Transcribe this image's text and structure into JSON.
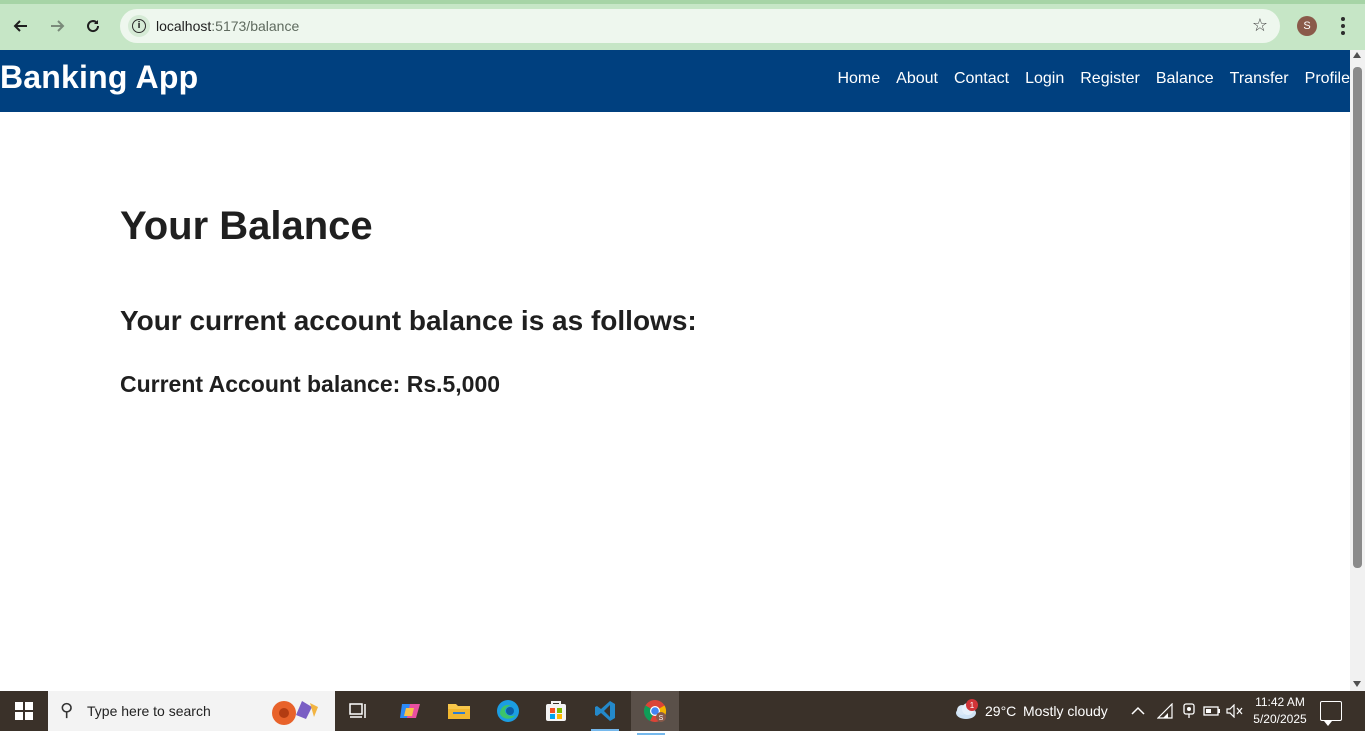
{
  "browser": {
    "url_host": "localhost",
    "url_path": ":5173/balance",
    "profile_initial": "S"
  },
  "app": {
    "brand": "Banking App",
    "nav": [
      {
        "label": "Home"
      },
      {
        "label": "About"
      },
      {
        "label": "Contact"
      },
      {
        "label": "Login"
      },
      {
        "label": "Register"
      },
      {
        "label": "Balance"
      },
      {
        "label": "Transfer"
      },
      {
        "label": "Profile"
      }
    ],
    "colors": {
      "navbar": "#00407f",
      "browser_chrome": "#c6e6c6"
    }
  },
  "main": {
    "title": "Your Balance",
    "subtitle": "Your current account balance is as follows:",
    "balance_label": "Current Account balance: ",
    "balance_amount": "Rs.5,000"
  },
  "taskbar": {
    "search_placeholder": "Type here to search",
    "weather_temp": "29°C",
    "weather_desc": "Mostly cloudy",
    "weather_badge": "1",
    "time": "11:42 AM",
    "date": "5/20/2025",
    "icons": [
      "task-view-icon",
      "copilot-icon",
      "file-explorer-icon",
      "edge-icon",
      "store-icon",
      "vscode-icon",
      "chrome-icon"
    ]
  }
}
